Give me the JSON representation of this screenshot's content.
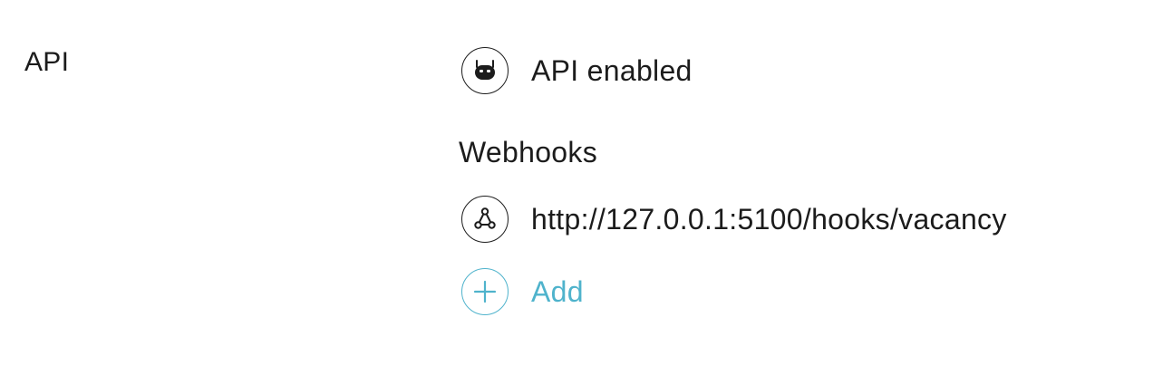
{
  "section": {
    "label": "API"
  },
  "api_status": {
    "icon": "robot-icon",
    "label": "API enabled"
  },
  "webhooks": {
    "heading": "Webhooks",
    "items": [
      {
        "icon": "webhook-icon",
        "url": "http://127.0.0.1:5100/hooks/vacancy"
      }
    ],
    "add": {
      "icon": "plus-icon",
      "label": "Add"
    }
  },
  "colors": {
    "text": "#1c1c1c",
    "accent": "#4fb3cc",
    "background": "#ffffff"
  }
}
